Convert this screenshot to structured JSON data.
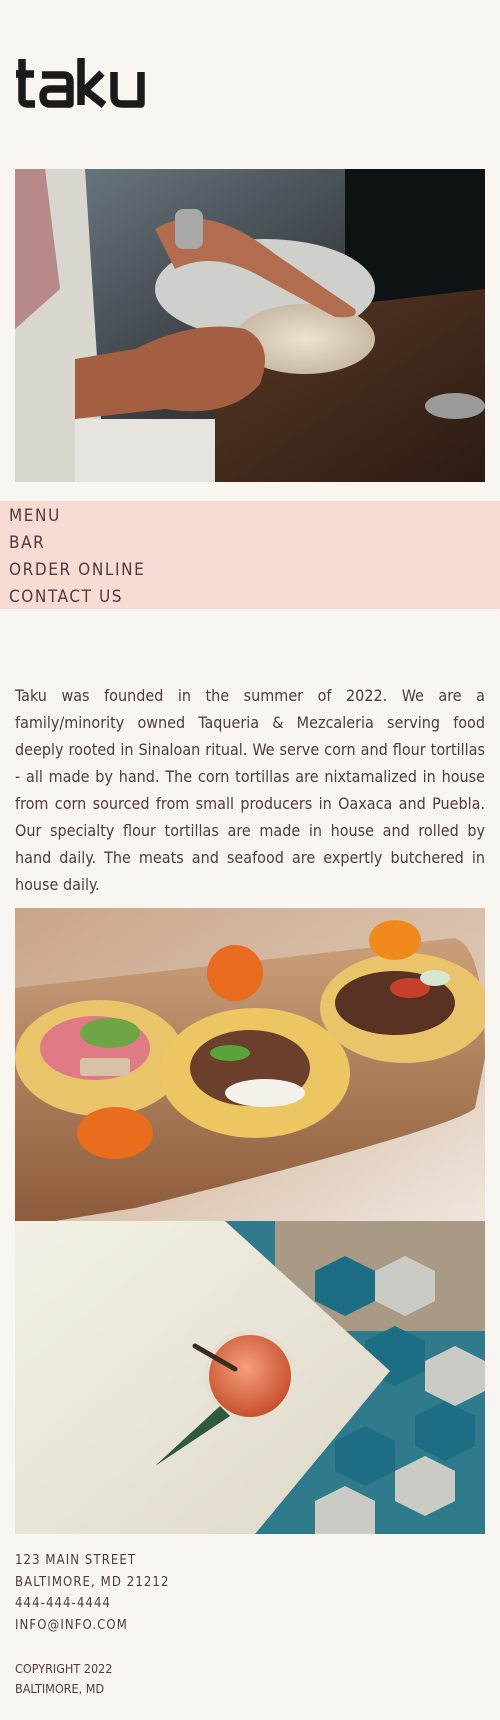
{
  "brand": {
    "logo_text": "taku"
  },
  "nav": {
    "items": [
      {
        "label": "MENU"
      },
      {
        "label": "BAR"
      },
      {
        "label": "ORDER ONLINE"
      },
      {
        "label": "CONTACT US"
      }
    ]
  },
  "about": {
    "text": "Taku was founded in the summer of 2022. We are a family/minority owned Taqueria & Mezcaleria serving food deeply rooted in Sinaloan ritual. We serve corn and flour tortillas - all made by hand. The corn tortillas are nixtamalized in house from corn sourced from small producers in Oaxaca and Puebla. Our specialty flour tortillas are made in house and rolled by hand daily. The meats and seafood are expertly butchered in house daily."
  },
  "footer": {
    "address_line1": "123 MAIN STREET",
    "address_line2": "BALTIMORE, MD 21212",
    "phone": "444-444-4444",
    "email": "INFO@INFO.COM",
    "copyright_line1": "COPYRIGHT 2022",
    "copyright_line2": "BALTIMORE, MD"
  },
  "colors": {
    "background": "#f9f6f2",
    "nav_background": "#f8dcd3",
    "text": "#4e3b3b",
    "logo": "#1a1a1a"
  }
}
